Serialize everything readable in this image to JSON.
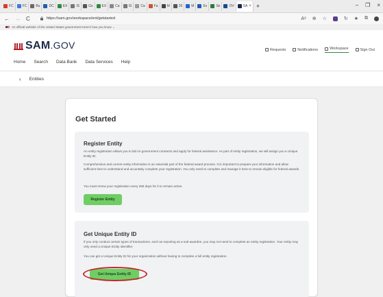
{
  "browser": {
    "tabs": [
      {
        "label": "FC",
        "color": "#d83b2b"
      },
      {
        "label": "FC",
        "color": "#3c7be0"
      },
      {
        "label": "Bu",
        "color": "#6a6a6a"
      },
      {
        "label": "DC",
        "color": "#1f5faa"
      },
      {
        "label": "EX",
        "color": "#2f8a3d"
      },
      {
        "label": "IS",
        "color": "#777777"
      },
      {
        "label": "Gs",
        "color": "#555555"
      },
      {
        "label": "EX",
        "color": "#2f8a3d"
      },
      {
        "label": "Ca",
        "color": "#888888"
      },
      {
        "label": "IS",
        "color": "#777777"
      },
      {
        "label": "Ca",
        "color": "#999999"
      },
      {
        "label": "Fa",
        "color": "#cc5533"
      },
      {
        "label": "M",
        "color": "#444444"
      },
      {
        "label": "26",
        "color": "#555555"
      },
      {
        "label": "M",
        "color": "#2266cc"
      },
      {
        "label": "Ex",
        "color": "#2060b0"
      },
      {
        "label": "Se",
        "color": "#2f7a3d"
      },
      {
        "label": "OV",
        "color": "#1a4a8a"
      }
    ],
    "active_tab": {
      "label": "SA",
      "close": "×"
    },
    "new_tab": "+",
    "window_controls": {
      "minimize": "–",
      "restore": "❐",
      "close": "×"
    },
    "nav": {
      "back": "←",
      "forward": "→",
      "reload": "C"
    },
    "url": "https://sam.gov/workspace/ent/getstarted"
  },
  "gov_banner": "An official website of the United States government   Here's how you know ⌄",
  "header": {
    "logo_main": "SAM",
    "logo_suffix": ".GOV",
    "tools": [
      {
        "label": "Requests"
      },
      {
        "label": "Notifications"
      },
      {
        "label": "Workspace"
      },
      {
        "label": "Sign Out"
      }
    ],
    "nav": [
      "Home",
      "Search",
      "Data Bank",
      "Data Services",
      "Help"
    ]
  },
  "breadcrumb": {
    "back_icon": "‹",
    "label": "Entities"
  },
  "card": {
    "title": "Get Started",
    "register": {
      "heading": "Register Entity",
      "p1": "An entity registration allows you to bid on government contracts and apply for federal assistance. As part of entity registration, we will assign you a Unique Entity ID.",
      "p2": "Comprehensive and current entity information is an essential part of the federal award process. It is important to prepare your information and allow sufficient time to understand and accurately complete your registration. You only need to complete and manage it here to remain eligible for federal awards.",
      "p3": "You must renew your registration every 365 days for it to remain active.",
      "button": "Register Entity"
    },
    "uei": {
      "heading": "Get Unique Entity ID",
      "p1": "If you only conduct certain types of transactions, such as reporting as a sub-awardee, you may not need to complete an entity registration. Your entity may only need a Unique Entity Identifier.",
      "p2": "You can get a Unique Entity ID for your organization without having to complete a full entity registration.",
      "button": "Get Unique Entity ID"
    }
  },
  "colors": {
    "brand": "#1b2a47",
    "brand_red": "#b3202a",
    "button_green": "#6fce63",
    "highlight": "#c8222a"
  }
}
